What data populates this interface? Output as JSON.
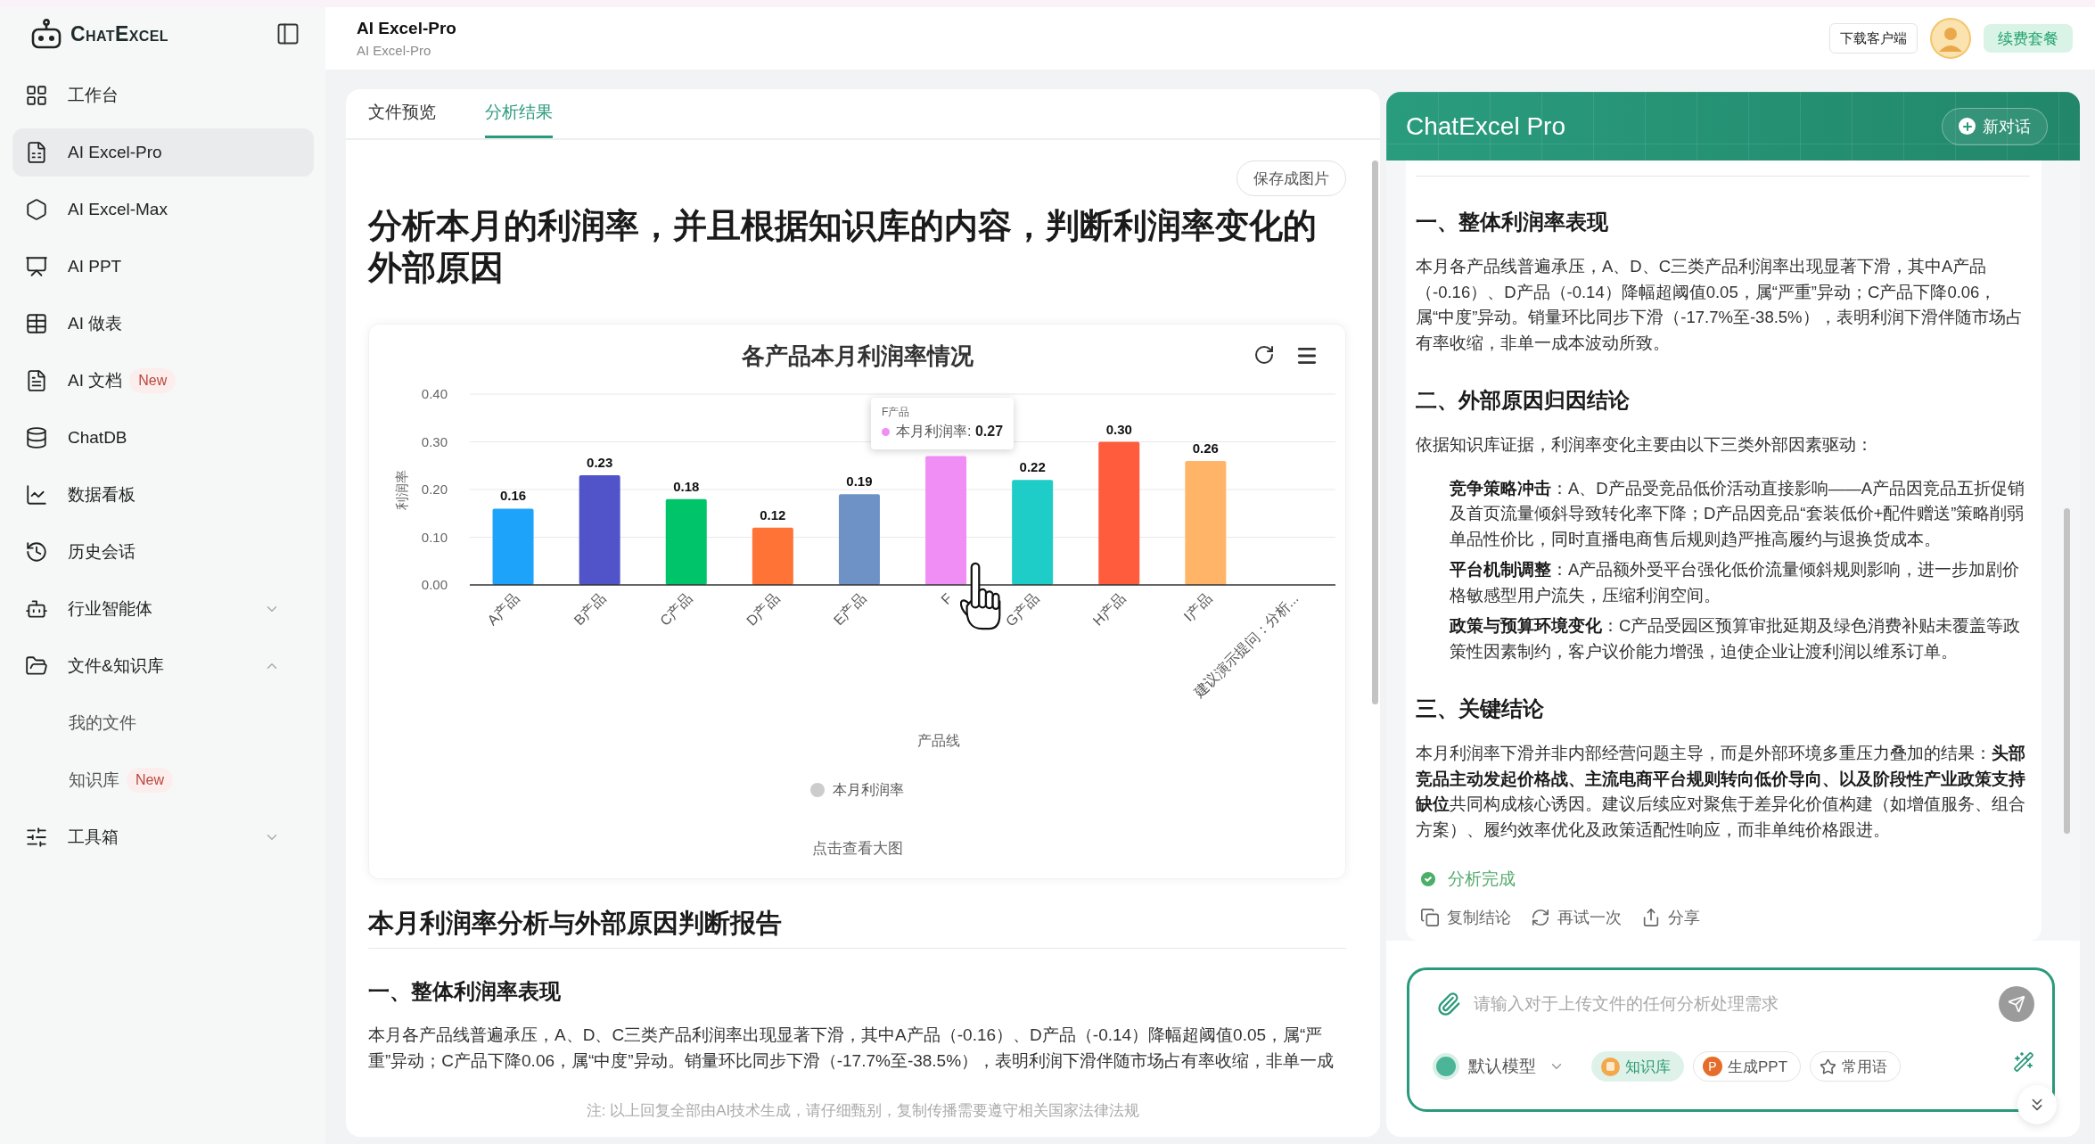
{
  "sidebar": {
    "brand": "ChatExcel",
    "items": [
      {
        "kind": "link",
        "label": "工作台",
        "selected": false
      },
      {
        "kind": "link",
        "label": "AI Excel-Pro",
        "selected": true
      },
      {
        "kind": "link",
        "label": "AI Excel-Max",
        "selected": false
      },
      {
        "kind": "link",
        "label": "AI PPT",
        "selected": false
      },
      {
        "kind": "link",
        "label": "AI 做表",
        "selected": false
      },
      {
        "kind": "link",
        "label": "AI 文档",
        "selected": false,
        "badge": "New"
      },
      {
        "kind": "link",
        "label": "ChatDB",
        "selected": false
      },
      {
        "kind": "link",
        "label": "数据看板",
        "selected": false
      },
      {
        "kind": "link",
        "label": "历史会话",
        "selected": false
      },
      {
        "kind": "group",
        "label": "行业智能体",
        "selected": false,
        "expanded": false
      },
      {
        "kind": "group",
        "label": "文件&知识库",
        "selected": false,
        "expanded": true,
        "children": [
          {
            "label": "我的文件",
            "selected": false
          },
          {
            "label": "知识库",
            "selected": false,
            "badge": "New"
          }
        ]
      },
      {
        "kind": "group",
        "label": "工具箱",
        "selected": false,
        "expanded": false
      }
    ]
  },
  "header": {
    "title": "AI Excel-Pro",
    "subtitle": "AI Excel-Pro",
    "download_button": "下载客户端",
    "renew_button": "续费套餐"
  },
  "workspace": {
    "tabs": [
      {
        "label": "文件预览",
        "selected": false
      },
      {
        "label": "分析结果",
        "selected": true
      }
    ],
    "save_button": "保存成图片",
    "question": "分析本月的利润率，并且根据知识库的内容，判断利润率变化的外部原因",
    "chart_card": {
      "chart_data": {
        "type": "bar",
        "title": "各产品本月利润率情况",
        "xlabel": "产品线",
        "ylabel": "利润率",
        "categories": [
          "A产品",
          "B产品",
          "C产品",
          "D产品",
          "E产品",
          "F",
          "G产品",
          "H产品",
          "I产品",
          "建议演示提问：分析..."
        ],
        "series": [
          {
            "name": "本月利润率",
            "values": [
              0.16,
              0.23,
              0.18,
              0.12,
              0.19,
              0.27,
              0.22,
              0.3,
              0.26,
              null
            ]
          }
        ],
        "ylim": [
          0,
          0.4
        ],
        "yticks": [
          {
            "value": 0,
            "label": "0.00"
          },
          {
            "value": 0.1,
            "label": "0.10"
          },
          {
            "value": 0.2,
            "label": "0.20"
          },
          {
            "value": 0.3,
            "label": "0.30"
          },
          {
            "value": 0.4,
            "label": "0.40"
          }
        ],
        "grid": true,
        "value_labels": [
          "0.16",
          "0.23",
          "0.18",
          "0.12",
          "0.19",
          null,
          "0.22",
          "0.30",
          "0.26",
          null
        ]
      },
      "bars": [
        {
          "color": "#1ea3fb"
        },
        {
          "color": "#5054c8"
        },
        {
          "color": "#00c46a"
        },
        {
          "color": "#ff7436"
        },
        {
          "color": "#6e92c6"
        },
        {
          "color": "#f18ef6",
          "tooltip": {
            "title": "F产品",
            "text": "本月利润率: **0.27**"
          }
        },
        {
          "color": "#1ecdc8"
        },
        {
          "color": "#ff5b3d"
        },
        {
          "color": "#ffb468"
        }
      ],
      "view_large": "点击查看大图"
    },
    "report": {
      "title": "本月利润率分析与外部原因判断报告",
      "sections": [
        {
          "heading": "一、整体利润率表现",
          "blocks": [
            {
              "kind": "paragraph",
              "text": "本月各产品线普遍承压，A、D、C三类产品利润率出现显著下滑，其中A产品（-0.16）、D产品（-0.14）降幅超阈值0.05，属“严重”异动；C产品下降0.06，属“中度”异动。销量环比同步下滑（-17.7%至-38.5%），表明利润下滑伴随市场占有率收缩，非单一成"
            }
          ]
        }
      ]
    },
    "disclaimer": "注: 以上回复全部由AI技术生成，请仔细甄别，复制传播需要遵守相关国家法律法规"
  },
  "assistant": {
    "title": "ChatExcel Pro",
    "new_chat_button": "新对话",
    "sections": [
      {
        "heading": "一、整体利润率表现",
        "blocks": [
          {
            "kind": "paragraph",
            "text": "本月各产品线普遍承压，A、D、C三类产品利润率出现显著下滑，其中A产品（-0.16）、D产品（-0.14）降幅超阈值0.05，属“严重”异动；C产品下降0.06，属“中度”异动。销量环比同步下滑（-17.7%至-38.5%），表明利润下滑伴随市场占有率收缩，非单一成本波动所致。"
          }
        ]
      },
      {
        "heading": "二、外部原因归因结论",
        "blocks": [
          {
            "kind": "paragraph",
            "text": "依据知识库证据，利润率变化主要由以下三类外部因素驱动："
          },
          {
            "kind": "point",
            "text": "**竞争策略冲击**：A、D产品受竞品低价活动直接影响——A产品因竞品五折促销及首页流量倾斜导致转化率下降；D产品因竞品“套装低价+配件赠送”策略削弱单品性价比，同时直播电商售后规则趋严推高履约与退换货成本。"
          },
          {
            "kind": "point",
            "text": "**平台机制调整**：A产品额外受平台强化低价流量倾斜规则影响，进一步加剧价格敏感型用户流失，压缩利润空间。"
          },
          {
            "kind": "point",
            "text": "**政策与预算环境变化**：C产品受园区预算审批延期及绿色消费补贴未覆盖等政策性因素制约，客户议价能力增强，迫使企业让渡利润以维系订单。"
          }
        ]
      },
      {
        "heading": "三、关键结论",
        "blocks": [
          {
            "kind": "paragraph",
            "text": "本月利润率下滑并非内部经营问题主导，而是外部环境多重压力叠加的结果：**头部竞品主动发起价格战、主流电商平台规则转向低价导向、以及阶段性产业政策支持缺位**共同构成核心诱因。建议后续应对聚焦于差异化价值构建（如增值服务、组合方案）、履约效率优化及政策适配性响应，而非单纯价格跟进。"
          }
        ]
      }
    ],
    "status": "分析完成",
    "actions": [
      "复制结论",
      "再试一次",
      "分享"
    ],
    "composer": {
      "placeholder": "请输入对于上传文件的任何分析处理需求",
      "model": "默认模型",
      "chips": [
        {
          "label": "知识库",
          "selected": true
        },
        {
          "label": "生成PPT",
          "selected": false,
          "badge": "P"
        },
        {
          "label": "常用语",
          "selected": false
        }
      ]
    }
  }
}
